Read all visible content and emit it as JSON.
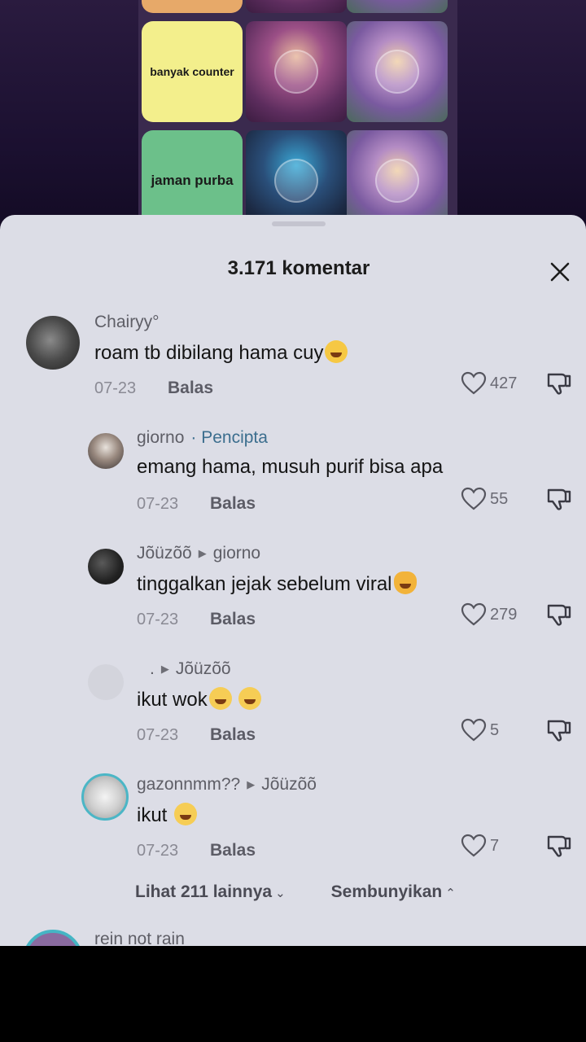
{
  "background": {
    "tiers": [
      {
        "label": "banyak counter",
        "color": "#f3ef8c"
      },
      {
        "label": "jaman purba",
        "color": "#6cc08a"
      }
    ]
  },
  "sheet": {
    "title": "3.171 komentar",
    "close_icon": "close-icon"
  },
  "comments": [
    {
      "username": "Chairyy°",
      "text": "roam tb dibilang hama cuy",
      "emoji": "joy-emoji",
      "date": "07-23",
      "reply_label": "Balas",
      "likes": "427"
    },
    {
      "username": "giorno",
      "creator_tag": "· Pencipta",
      "text": "emang hama, musuh purif bisa apa",
      "date": "07-23",
      "reply_label": "Balas",
      "likes": "55"
    },
    {
      "username": "Jõüzõõ",
      "reply_to": "giorno",
      "text": "tinggalkan jejak sebelum viral",
      "emoji": "joy-cat-emoji",
      "date": "07-23",
      "reply_label": "Balas",
      "likes": "279"
    },
    {
      "username": ".",
      "reply_to": "Jõüzõõ",
      "text": "ikut wok",
      "emoji": "grin-emoji",
      "date": "07-23",
      "reply_label": "Balas",
      "likes": "5"
    },
    {
      "username": "gazonnmm??",
      "reply_to": "Jõüzõõ",
      "text": "ikut",
      "emoji": "grin-emoji",
      "date": "07-23",
      "reply_label": "Balas",
      "likes": "7"
    }
  ],
  "more": {
    "show_more": "Lihat 211 lainnya",
    "hide": "Sembunyikan"
  },
  "next_comment": {
    "username": "rein not rain"
  },
  "colors": {
    "sheet_bg": "#dcdde6",
    "creator_tag": "#3c6e8e"
  }
}
